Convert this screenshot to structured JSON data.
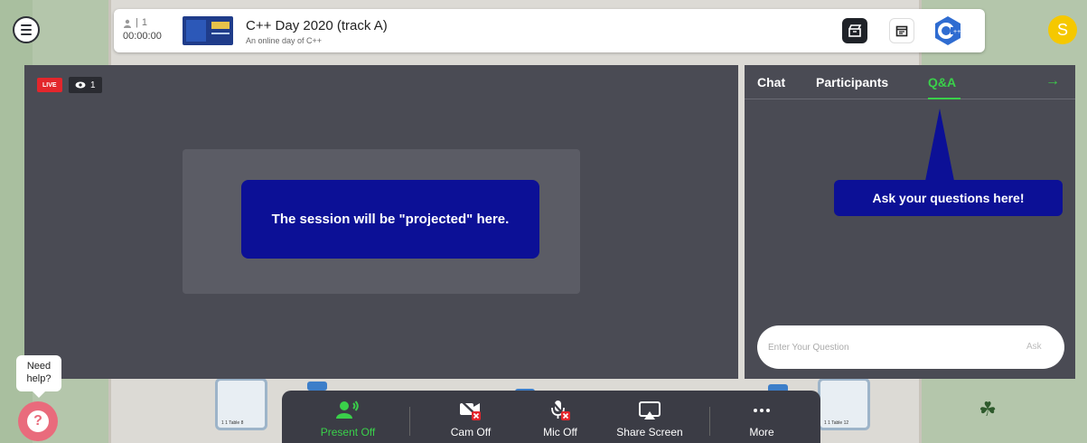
{
  "event": {
    "title": "C++ Day 2020 (track A)",
    "subtitle": "An online day of C++",
    "participant_count": "1",
    "timer": "00:00:00"
  },
  "user": {
    "avatar_initial": "S",
    "avatar_color": "#f5c800"
  },
  "stage": {
    "live_label": "LIVE",
    "viewer_count": "1",
    "message": "The session will be \"projected\" here."
  },
  "side_panel": {
    "tabs": [
      {
        "label": "Chat",
        "active": false
      },
      {
        "label": "Participants",
        "active": false
      },
      {
        "label": "Q&A",
        "active": true
      }
    ],
    "callout": "Ask your questions here!",
    "question_placeholder": "Enter Your Question",
    "ask_label": "Ask"
  },
  "help": {
    "label_line1": "Need",
    "label_line2": "help?"
  },
  "toolbar": {
    "present": "Present Off",
    "cam": "Cam Off",
    "mic": "Mic Off",
    "share": "Share Screen",
    "more": "More"
  },
  "tables": {
    "left_label": "1 1 Table 8",
    "right_label": "1 1 Table 12"
  },
  "colors": {
    "accent_green": "#3ad04a",
    "callout_blue": "#0c1096",
    "live_red": "#e3262c",
    "panel": "#4a4b54"
  },
  "icons": [
    "menu-icon",
    "person-icon",
    "clapperboard-icon",
    "calendar-icon",
    "cpp-logo",
    "eye-icon",
    "arrow-right-icon",
    "question-icon",
    "present-icon",
    "cam-off-icon",
    "mic-off-icon",
    "share-screen-icon",
    "more-icon"
  ]
}
